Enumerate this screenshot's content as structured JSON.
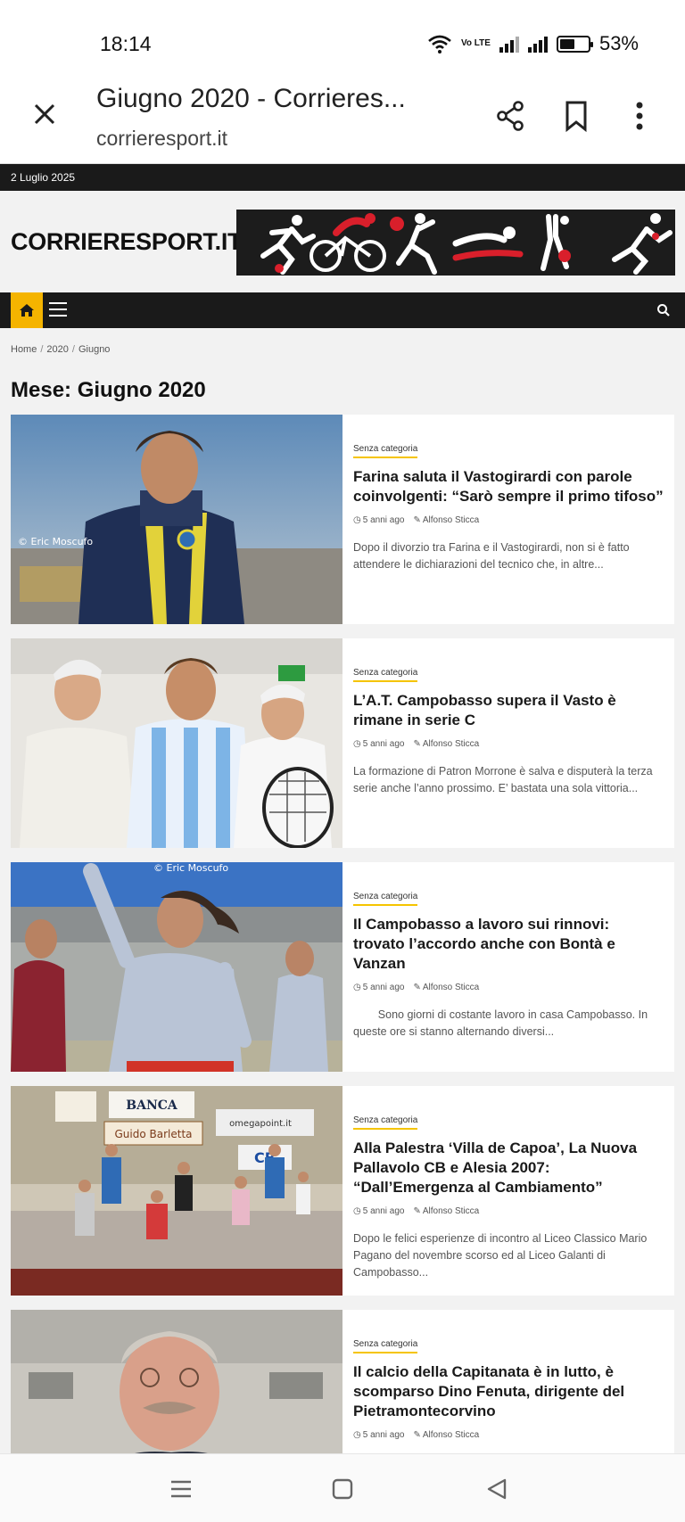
{
  "status": {
    "time": "18:14",
    "battery": "53%",
    "battery_level": 0.53,
    "volte": "Vo LTE"
  },
  "browser": {
    "title": "Giugno 2020 - Corrieres...",
    "url": "corrieresport.it"
  },
  "site": {
    "date": "2 Luglio 2025",
    "logo": "CORRIERESPORT.IT",
    "breadcrumb": [
      "Home",
      "2020",
      "Giugno"
    ],
    "archive_title": "Mese: Giugno 2020",
    "accent": "#f5b400"
  },
  "posts": [
    {
      "category": "Senza categoria",
      "title": "Farina saluta il Vastogirardi con parole coinvolgenti: “Sarò sempre il primo tifoso”",
      "time": "5 anni ago",
      "author": "Alfonso Sticca",
      "excerpt": "Dopo il divorzio tra Farina e il Vastogirardi, non si è fatto attendere le dichiarazioni del tecnico che, in altre...",
      "watermark": "© Eric Moscufo"
    },
    {
      "category": "Senza categoria",
      "title": "L’A.T. Campobasso supera il Vasto è rimane in serie C",
      "time": "5 anni ago",
      "author": "Alfonso Sticca",
      "excerpt": "La formazione di Patron Morrone è salva e disputerà la terza serie anche l’anno prossimo. E’ bastata una sola vittoria..."
    },
    {
      "category": "Senza categoria",
      "title": "Il Campobasso a lavoro sui rinnovi: trovato l’accordo anche con Bontà e Vanzan",
      "time": "5 anni ago",
      "author": "Alfonso Sticca",
      "excerpt": "        Sono giorni di costante lavoro in casa Campobasso. In queste ore si stanno alternando diversi...",
      "watermark": "© Eric Moscufo"
    },
    {
      "category": "Senza categoria",
      "title": "Alla Palestra ‘Villa de Capoa’, La Nuova Pallavolo CB e Alesia 2007: “Dall’Emergenza al Cambiamento”",
      "time": "5 anni ago",
      "author": "Alfonso Sticca",
      "excerpt": "Dopo le felici esperienze di incontro al Liceo Classico Mario Pagano del novembre scorso ed al Liceo Galanti di Campobasso...",
      "signs": [
        "BANCA",
        "Guido Barletta",
        "omegapoint.it",
        "CB"
      ]
    },
    {
      "category": "Senza categoria",
      "title": "Il calcio della Capitanata è in lutto, è scomparso Dino Fenuta, dirigente del Pietramontecorvino",
      "time": "5 anni ago",
      "author": "Alfonso Sticca",
      "excerpt": ""
    }
  ]
}
